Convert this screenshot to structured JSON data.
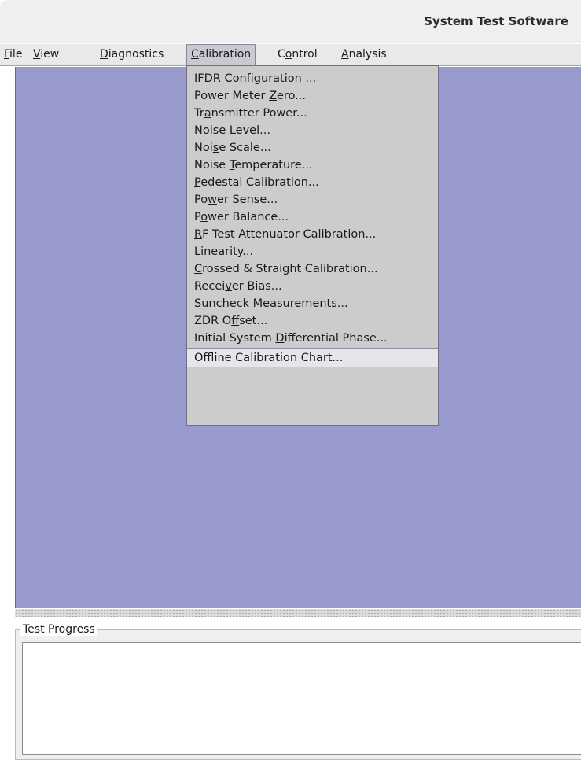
{
  "window": {
    "title": "System Test Software"
  },
  "menubar": {
    "items": [
      {
        "label": "File",
        "mnemonic_index": 0
      },
      {
        "label": "View",
        "mnemonic_index": 0
      },
      {
        "label": "Diagnostics",
        "mnemonic_index": 0
      },
      {
        "label": "Calibration",
        "mnemonic_index": 0,
        "active": true
      },
      {
        "label": "Control",
        "mnemonic_index": 1
      },
      {
        "label": "Analysis",
        "mnemonic_index": 0
      }
    ]
  },
  "calibration_menu": {
    "items": [
      {
        "label": "IFDR Configuration ...",
        "mnemonic_index": 10
      },
      {
        "label": "Power Meter Zero...",
        "mnemonic_index": 12
      },
      {
        "label": "Transmitter Power...",
        "mnemonic_index": 2
      },
      {
        "label": "Noise Level...",
        "mnemonic_index": 0
      },
      {
        "label": "Noise Scale...",
        "mnemonic_index": 3
      },
      {
        "label": "Noise Temperature...",
        "mnemonic_index": 6
      },
      {
        "label": "Pedestal Calibration...",
        "mnemonic_index": 0
      },
      {
        "label": "Power Sense...",
        "mnemonic_index": 2
      },
      {
        "label": "Power Balance...",
        "mnemonic_index": 1
      },
      {
        "label": "RF Test Attenuator Calibration...",
        "mnemonic_index": 0
      },
      {
        "label": "Linearity...",
        "mnemonic_index": 8
      },
      {
        "label": "Crossed & Straight Calibration...",
        "mnemonic_index": 0
      },
      {
        "label": "Receiver Bias...",
        "mnemonic_index": 5
      },
      {
        "label": "Suncheck Measurements...",
        "mnemonic_index": 1
      },
      {
        "label": "ZDR Offset...",
        "mnemonic_index": 5
      },
      {
        "label": "Initial System Differential Phase...",
        "mnemonic_index": 15
      },
      {
        "label": "Offline Calibration Chart...",
        "mnemonic_index": 3
      }
    ]
  },
  "progress_panel": {
    "title": "Test Progress"
  },
  "colors": {
    "desktop": "#9899cc",
    "menu_background": "#cccccc",
    "menubar_background": "#e9e9e9"
  }
}
